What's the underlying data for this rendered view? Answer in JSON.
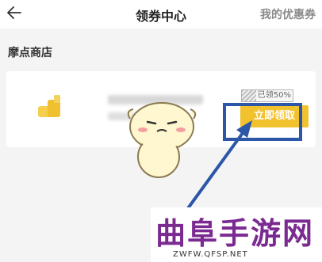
{
  "header": {
    "title": "领券中心",
    "my_coupons_label": "我的优惠券",
    "back_icon": "arrow-left-icon"
  },
  "section": {
    "title": "摩点商店"
  },
  "coupon": {
    "claimed_text": "已领50%",
    "claimed_fraction": 0.5,
    "claim_button_label": "立即领取",
    "accent_color": "#f2c12e"
  },
  "overlay": {
    "highlight_color": "#2c56a8"
  },
  "watermark": {
    "title": "曲阜手游网",
    "url": "ZWFW.QFSP.NET"
  }
}
